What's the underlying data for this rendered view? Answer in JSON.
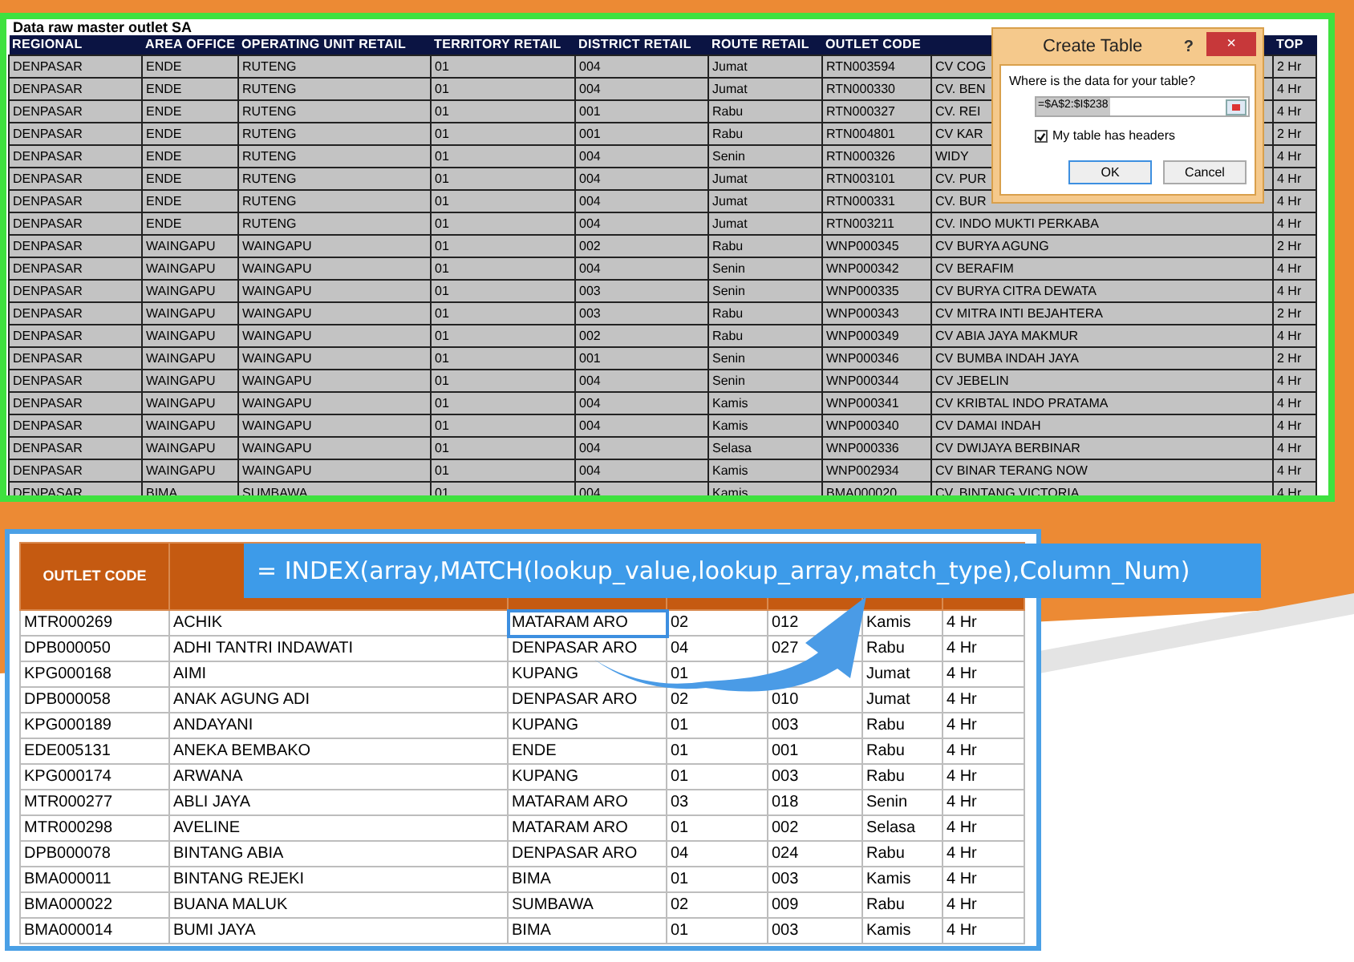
{
  "raw_sheet": {
    "title": "Data raw master outlet SA",
    "columns": [
      "REGIONAL",
      "AREA OFFICE",
      "OPERATING UNIT RETAIL",
      "TERRITORY RETAIL",
      "DISTRICT RETAIL",
      "ROUTE RETAIL",
      "OUTLET CODE",
      null,
      "TOP"
    ],
    "rows": [
      [
        "DENPASAR",
        "ENDE",
        "RUTENG",
        "01",
        "004",
        "Jumat",
        "RTN003594",
        "CV COG",
        "2 Hr"
      ],
      [
        "DENPASAR",
        "ENDE",
        "RUTENG",
        "01",
        "004",
        "Jumat",
        "RTN000330",
        "CV. BEN",
        "4 Hr"
      ],
      [
        "DENPASAR",
        "ENDE",
        "RUTENG",
        "01",
        "001",
        "Rabu",
        "RTN000327",
        "CV. REI",
        "4 Hr"
      ],
      [
        "DENPASAR",
        "ENDE",
        "RUTENG",
        "01",
        "001",
        "Rabu",
        "RTN004801",
        "CV KAR",
        "2 Hr"
      ],
      [
        "DENPASAR",
        "ENDE",
        "RUTENG",
        "01",
        "004",
        "Senin",
        "RTN000326",
        "WIDY",
        "4 Hr"
      ],
      [
        "DENPASAR",
        "ENDE",
        "RUTENG",
        "01",
        "004",
        "Jumat",
        "RTN003101",
        "CV. PUR",
        "4 Hr"
      ],
      [
        "DENPASAR",
        "ENDE",
        "RUTENG",
        "01",
        "004",
        "Jumat",
        "RTN000331",
        "CV. BUR",
        "4 Hr"
      ],
      [
        "DENPASAR",
        "ENDE",
        "RUTENG",
        "01",
        "004",
        "Jumat",
        "RTN003211",
        "CV. INDO MUKTI PERKABA",
        "4 Hr"
      ],
      [
        "DENPASAR",
        "WAINGAPU",
        "WAINGAPU",
        "01",
        "002",
        "Rabu",
        "WNP000345",
        "CV BURYA AGUNG",
        "2 Hr"
      ],
      [
        "DENPASAR",
        "WAINGAPU",
        "WAINGAPU",
        "01",
        "004",
        "Senin",
        "WNP000342",
        "CV BERAFIM",
        "4 Hr"
      ],
      [
        "DENPASAR",
        "WAINGAPU",
        "WAINGAPU",
        "01",
        "003",
        "Senin",
        "WNP000335",
        "CV BURYA CITRA DEWATA",
        "4 Hr"
      ],
      [
        "DENPASAR",
        "WAINGAPU",
        "WAINGAPU",
        "01",
        "003",
        "Rabu",
        "WNP000343",
        "CV MITRA INTI BEJAHTERA",
        "2 Hr"
      ],
      [
        "DENPASAR",
        "WAINGAPU",
        "WAINGAPU",
        "01",
        "002",
        "Rabu",
        "WNP000349",
        "CV ABIA JAYA MAKMUR",
        "4 Hr"
      ],
      [
        "DENPASAR",
        "WAINGAPU",
        "WAINGAPU",
        "01",
        "001",
        "Senin",
        "WNP000346",
        "CV BUMBA INDAH JAYA",
        "2 Hr"
      ],
      [
        "DENPASAR",
        "WAINGAPU",
        "WAINGAPU",
        "01",
        "004",
        "Senin",
        "WNP000344",
        "CV JEBELIN",
        "4 Hr"
      ],
      [
        "DENPASAR",
        "WAINGAPU",
        "WAINGAPU",
        "01",
        "004",
        "Kamis",
        "WNP000341",
        "CV KRIBTAL INDO PRATAMA",
        "4 Hr"
      ],
      [
        "DENPASAR",
        "WAINGAPU",
        "WAINGAPU",
        "01",
        "004",
        "Kamis",
        "WNP000340",
        "CV DAMAI INDAH",
        "4 Hr"
      ],
      [
        "DENPASAR",
        "WAINGAPU",
        "WAINGAPU",
        "01",
        "004",
        "Selasa",
        "WNP000336",
        "CV DWIJAYA BERBINAR",
        "4 Hr"
      ],
      [
        "DENPASAR",
        "WAINGAPU",
        "WAINGAPU",
        "01",
        "004",
        "Kamis",
        "WNP002934",
        "CV BINAR TERANG NOW",
        "4 Hr"
      ],
      [
        "DENPASAR",
        "BIMA",
        "SUMBAWA",
        "01",
        "004",
        "Kamis",
        "BMA000020",
        "CV. BINTANG VICTORIA",
        "4 Hr"
      ]
    ]
  },
  "dialog": {
    "title": "Create Table",
    "help": "?",
    "close": "×",
    "prompt": "Where is the data for your table?",
    "range_value": "=$A$2:$I$238",
    "headers_checkbox": {
      "label": "My table has headers",
      "checked": true
    },
    "buttons": [
      "OK",
      "Cancel"
    ]
  },
  "lookup_sheet": {
    "header": "OUTLET CODE",
    "rows": [
      {
        "selected": true,
        "cells": [
          "MTR000269",
          "ACHIK",
          "MATARAM ARO",
          "02",
          "012",
          "Kamis",
          "4 Hr"
        ]
      },
      {
        "selected": false,
        "cells": [
          "DPB000050",
          "ADHI TANTRI INDAWATI",
          "DENPASAR ARO",
          "04",
          "027",
          "Rabu",
          "4 Hr"
        ]
      },
      {
        "selected": false,
        "cells": [
          "KPG000168",
          "AIMI",
          "KUPANG",
          "01",
          null,
          "Jumat",
          "4 Hr"
        ]
      },
      {
        "selected": false,
        "cells": [
          "DPB000058",
          "ANAK AGUNG ADI",
          "DENPASAR ARO",
          "02",
          "010",
          "Jumat",
          "4 Hr"
        ]
      },
      {
        "selected": false,
        "cells": [
          "KPG000189",
          "ANDAYANI",
          "KUPANG",
          "01",
          "003",
          "Rabu",
          "4 Hr"
        ]
      },
      {
        "selected": false,
        "cells": [
          "EDE005131",
          "ANEKA BEMBAKO",
          "ENDE",
          "01",
          "001",
          "Rabu",
          "4 Hr"
        ]
      },
      {
        "selected": false,
        "cells": [
          "KPG000174",
          "ARWANA",
          "KUPANG",
          "01",
          "003",
          "Rabu",
          "4 Hr"
        ]
      },
      {
        "selected": false,
        "cells": [
          "MTR000277",
          "ABLI JAYA",
          "MATARAM ARO",
          "03",
          "018",
          "Senin",
          "4 Hr"
        ]
      },
      {
        "selected": false,
        "cells": [
          "MTR000298",
          "AVELINE",
          "MATARAM ARO",
          "01",
          "002",
          "Selasa",
          "4 Hr"
        ]
      },
      {
        "selected": false,
        "cells": [
          "DPB000078",
          "BINTANG ABIA",
          "DENPASAR ARO",
          "04",
          "024",
          "Rabu",
          "4 Hr"
        ]
      },
      {
        "selected": false,
        "cells": [
          "BMA000011",
          "BINTANG REJEKI",
          "BIMA",
          "01",
          "003",
          "Kamis",
          "4 Hr"
        ]
      },
      {
        "selected": false,
        "cells": [
          "BMA000022",
          "BUANA MALUK",
          "SUMBAWA",
          "02",
          "009",
          "Rabu",
          "4 Hr"
        ]
      },
      {
        "selected": false,
        "cells": [
          "BMA000014",
          "BUMI JAYA",
          "BIMA",
          "01",
          "003",
          "Kamis",
          "4 Hr"
        ]
      }
    ]
  },
  "formula_banner": "= INDEX(array,MATCH(lookup_value,lookup_array,match_type),Column_Num)"
}
